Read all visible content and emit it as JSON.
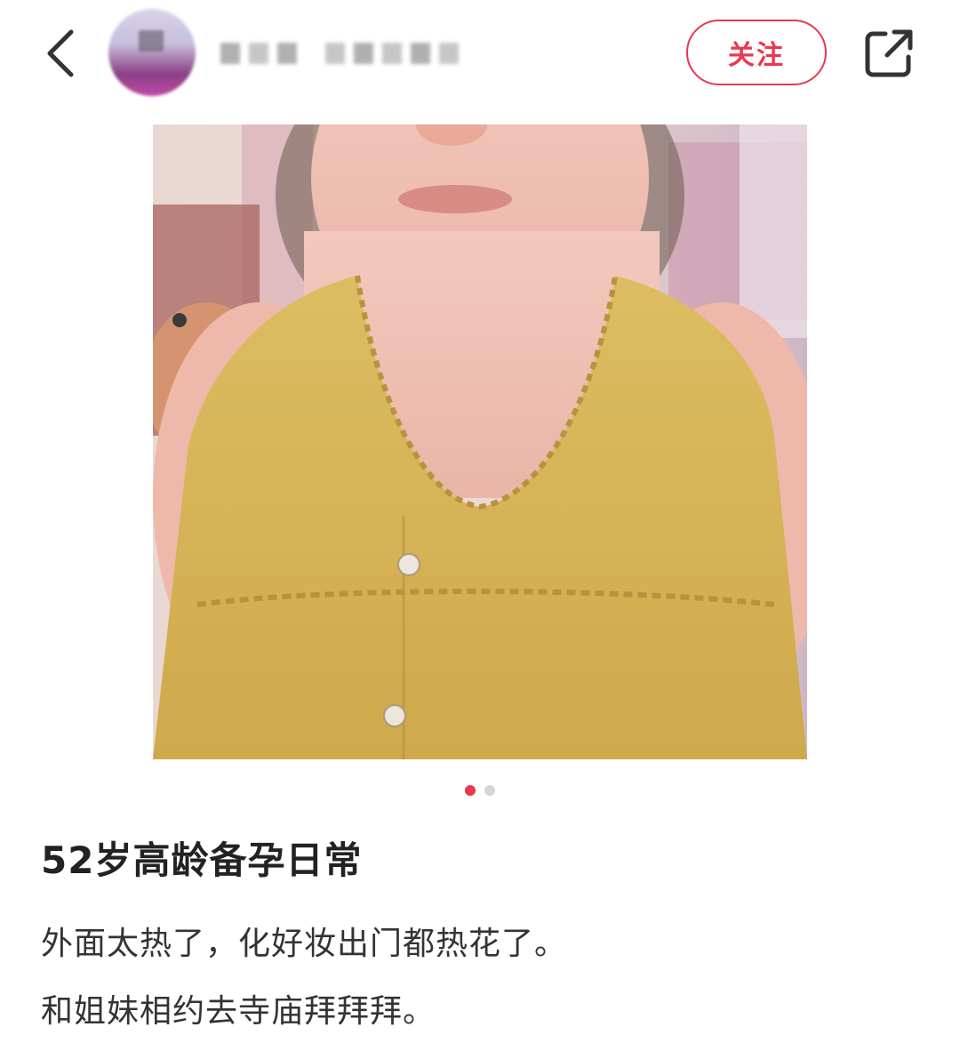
{
  "header": {
    "back_icon": "chevron-left-icon",
    "username": "",
    "follow_label": "关注",
    "share_icon": "share-external-icon",
    "accent_color": "#e8394f"
  },
  "photo": {
    "count": 2,
    "current_index": 1
  },
  "post": {
    "title": "52岁高龄备孕日常",
    "lines": [
      "外面太热了，化好妆出门都热花了。",
      "和姐妹相约去寺庙拜拜拜。"
    ]
  }
}
